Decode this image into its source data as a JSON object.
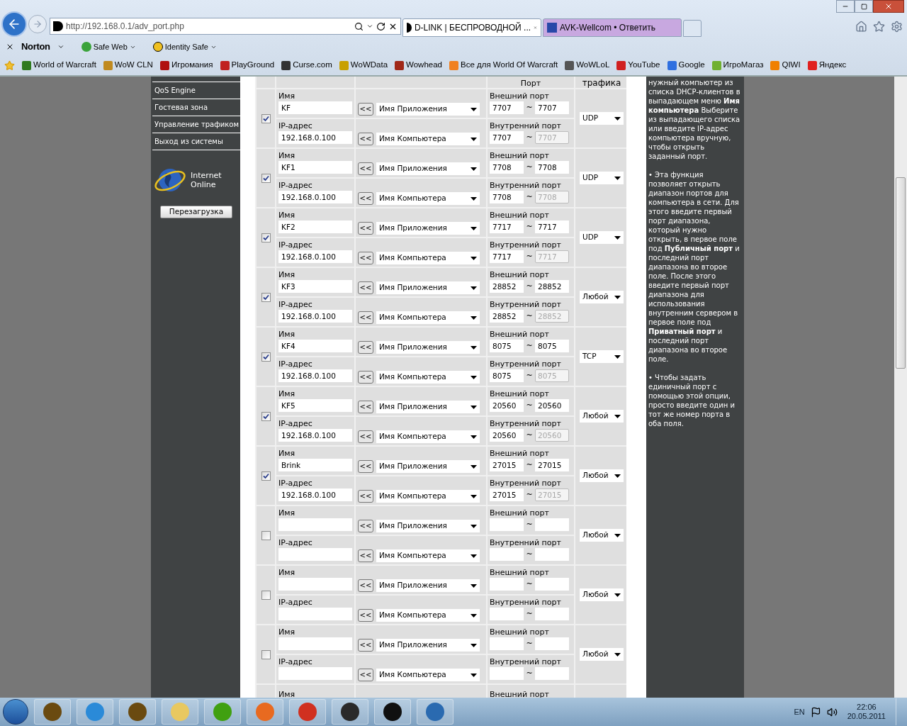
{
  "browser": {
    "address": "http://192.168.0.1/adv_port.php",
    "tabs": [
      {
        "label": "D-LINK | БЕСПРОВОДНОЙ ...",
        "selected": true
      },
      {
        "label": "AVK-Wellcom • Ответить",
        "selected": false
      }
    ],
    "norton": {
      "brand": "Norton",
      "items": [
        "Safe Web",
        "Identity Safe"
      ]
    },
    "favorites": [
      {
        "label": "World of Warcraft",
        "color": "#2f7a1e"
      },
      {
        "label": "WoW CLN",
        "color": "#c08a20"
      },
      {
        "label": "Игромания",
        "color": "#b01010"
      },
      {
        "label": "PlayGround",
        "color": "#c02020"
      },
      {
        "label": "Curse.com",
        "color": "#333333"
      },
      {
        "label": "WoWData",
        "color": "#c8a000"
      },
      {
        "label": "Wowhead",
        "color": "#a02818"
      },
      {
        "label": "Все для World Of Warcraft",
        "color": "#f08020"
      },
      {
        "label": "WoWLoL",
        "color": "#555555"
      },
      {
        "label": "YouTube",
        "color": "#d02020"
      },
      {
        "label": "Google",
        "color": "#3070e0"
      },
      {
        "label": "ИгроМагаз",
        "color": "#70b030"
      },
      {
        "label": "QIWI",
        "color": "#f08000"
      },
      {
        "label": "Яндекс",
        "color": "#e02020"
      }
    ]
  },
  "sidebar": {
    "items": [
      "QoS Engine",
      "Гостевая зона",
      "Управление трафиком",
      "Выход из системы"
    ],
    "status": [
      "Internet",
      "Online"
    ],
    "reboot_button": "Перезагрузка"
  },
  "table": {
    "header": [
      "Порт",
      "трафика"
    ],
    "rows": [
      {
        "checked": true,
        "name_label": "Имя",
        "name": "KF",
        "ip_label": "IP-адрес",
        "ip": "192.168.0.100",
        "arrow_1": "<<",
        "arrow_2": "<<",
        "app_select": "Имя Приложения",
        "pc_select": "Имя Компьютера",
        "ext_label": "Внешний порт",
        "ext_start": "7707",
        "ext_sep": "~",
        "ext_end": "7707",
        "int_label": "Внутренний порт",
        "int_start": "7707",
        "int_sep": "~",
        "int_end": "7707",
        "int_end_disabled": true,
        "protocol": "UDP"
      },
      {
        "checked": true,
        "name_label": "Имя",
        "name": "KF1",
        "ip_label": "IP-адрес",
        "ip": "192.168.0.100",
        "arrow_1": "<<",
        "arrow_2": "<<",
        "app_select": "Имя Приложения",
        "pc_select": "Имя Компьютера",
        "ext_label": "Внешний порт",
        "ext_start": "7708",
        "ext_sep": "~",
        "ext_end": "7708",
        "int_label": "Внутренний порт",
        "int_start": "7708",
        "int_sep": "~",
        "int_end": "7708",
        "int_end_disabled": true,
        "protocol": "UDP"
      },
      {
        "checked": true,
        "name_label": "Имя",
        "name": "KF2",
        "ip_label": "IP-адрес",
        "ip": "192.168.0.100",
        "arrow_1": "<<",
        "arrow_2": "<<",
        "app_select": "Имя Приложения",
        "pc_select": "Имя Компьютера",
        "ext_label": "Внешний порт",
        "ext_start": "7717",
        "ext_sep": "~",
        "ext_end": "7717",
        "int_label": "Внутренний порт",
        "int_start": "7717",
        "int_sep": "~",
        "int_end": "7717",
        "int_end_disabled": true,
        "protocol": "UDP"
      },
      {
        "checked": true,
        "name_label": "Имя",
        "name": "KF3",
        "ip_label": "IP-адрес",
        "ip": "192.168.0.100",
        "arrow_1": "<<",
        "arrow_2": "<<",
        "app_select": "Имя Приложения",
        "pc_select": "Имя Компьютера",
        "ext_label": "Внешний порт",
        "ext_start": "28852",
        "ext_sep": "~",
        "ext_end": "28852",
        "int_label": "Внутренний порт",
        "int_start": "28852",
        "int_sep": "~",
        "int_end": "28852",
        "int_end_disabled": true,
        "protocol": "Любой"
      },
      {
        "checked": true,
        "name_label": "Имя",
        "name": "KF4",
        "ip_label": "IP-адрес",
        "ip": "192.168.0.100",
        "arrow_1": "<<",
        "arrow_2": "<<",
        "app_select": "Имя Приложения",
        "pc_select": "Имя Компьютера",
        "ext_label": "Внешний порт",
        "ext_start": "8075",
        "ext_sep": "~",
        "ext_end": "8075",
        "int_label": "Внутренний порт",
        "int_start": "8075",
        "int_sep": "~",
        "int_end": "8075",
        "int_end_disabled": true,
        "protocol": "TCP"
      },
      {
        "checked": true,
        "name_label": "Имя",
        "name": "KF5",
        "ip_label": "IP-адрес",
        "ip": "192.168.0.100",
        "arrow_1": "<<",
        "arrow_2": "<<",
        "app_select": "Имя Приложения",
        "pc_select": "Имя Компьютера",
        "ext_label": "Внешний порт",
        "ext_start": "20560",
        "ext_sep": "~",
        "ext_end": "20560",
        "int_label": "Внутренний порт",
        "int_start": "20560",
        "int_sep": "~",
        "int_end": "20560",
        "int_end_disabled": true,
        "protocol": "Любой"
      },
      {
        "checked": true,
        "name_label": "Имя",
        "name": "Brink",
        "ip_label": "IP-адрес",
        "ip": "192.168.0.100",
        "arrow_1": "<<",
        "arrow_2": "<<",
        "app_select": "Имя Приложения",
        "pc_select": "Имя Компьютера",
        "ext_label": "Внешний порт",
        "ext_start": "27015",
        "ext_sep": "~",
        "ext_end": "27015",
        "int_label": "Внутренний порт",
        "int_start": "27015",
        "int_sep": "~",
        "int_end": "27015",
        "int_end_disabled": true,
        "protocol": "Любой"
      },
      {
        "checked": false,
        "name_label": "Имя",
        "ip_label": "IP-адрес",
        "arrow_1": "<<",
        "arrow_2": "<<",
        "app_select": "Имя Приложения",
        "pc_select": "Имя Компьютера",
        "ext_label": "Внешний порт",
        "ext_sep": "~",
        "int_label": "Внутренний порт",
        "int_sep": "~",
        "int_end_disabled": false,
        "protocol": "Любой"
      },
      {
        "checked": false,
        "name_label": "Имя",
        "ip_label": "IP-адрес",
        "arrow_1": "<<",
        "arrow_2": "<<",
        "app_select": "Имя Приложения",
        "pc_select": "Имя Компьютера",
        "ext_label": "Внешний порт",
        "ext_sep": "~",
        "int_label": "Внутренний порт",
        "int_sep": "~",
        "int_end_disabled": false,
        "protocol": "Любой"
      },
      {
        "checked": false,
        "name_label": "Имя",
        "ip_label": "IP-адрес",
        "arrow_1": "<<",
        "arrow_2": "<<",
        "app_select": "Имя Приложения",
        "pc_select": "Имя Компьютера",
        "ext_label": "Внешний порт",
        "ext_sep": "~",
        "int_label": "Внутренний порт",
        "int_sep": "~",
        "int_end_disabled": false,
        "protocol": "Любой"
      }
    ],
    "partial_row": {
      "name_label": "Имя",
      "ext_label": "Внешний порт"
    }
  },
  "help": [
    "нужный компьютер из списка DHCP-клиентов в выпадающем меню **Имя компьютера** Выберите из выпадающего списка или введите IP-адрес компьютера вручную, чтобы открыть заданный порт.",
    "• Эта функция позволяет открыть диапазон портов для компьютера в сети. Для этого введите первый порт диапазона, который нужно открыть, в первое поле под **Публичный порт** и последний порт диапазона во второе поле. После этого введите первый порт диапазона для использования внутренним сервером в первое поле под **Приватный порт** и последний порт диапазона во второе поле.",
    "• Чтобы задать единичный порт с помощью этой опции, просто введите один и тот же номер порта в оба поля."
  ],
  "taskbar": {
    "language": "EN",
    "time": "22:06",
    "date": "20.05.2011"
  }
}
